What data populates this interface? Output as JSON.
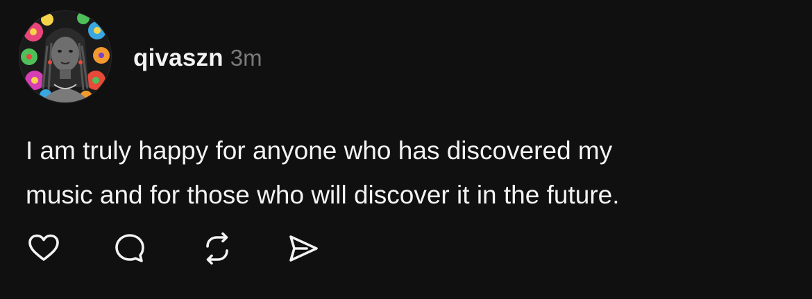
{
  "post": {
    "username": "qivaszn",
    "timestamp": "3m",
    "text_lines": [
      "I am truly happy for anyone who has discovered my",
      "music and for those who will discover it in the future."
    ],
    "avatar_icon": "profile-photo-floral-portrait"
  },
  "actions": {
    "like_icon": "heart-icon",
    "reply_icon": "speech-bubble-icon",
    "repost_icon": "repost-arrows-icon",
    "share_icon": "send-arrow-icon"
  },
  "colors": {
    "background": "#101010",
    "text": "#f3f3f3",
    "secondary_text": "#7a7a7a"
  }
}
